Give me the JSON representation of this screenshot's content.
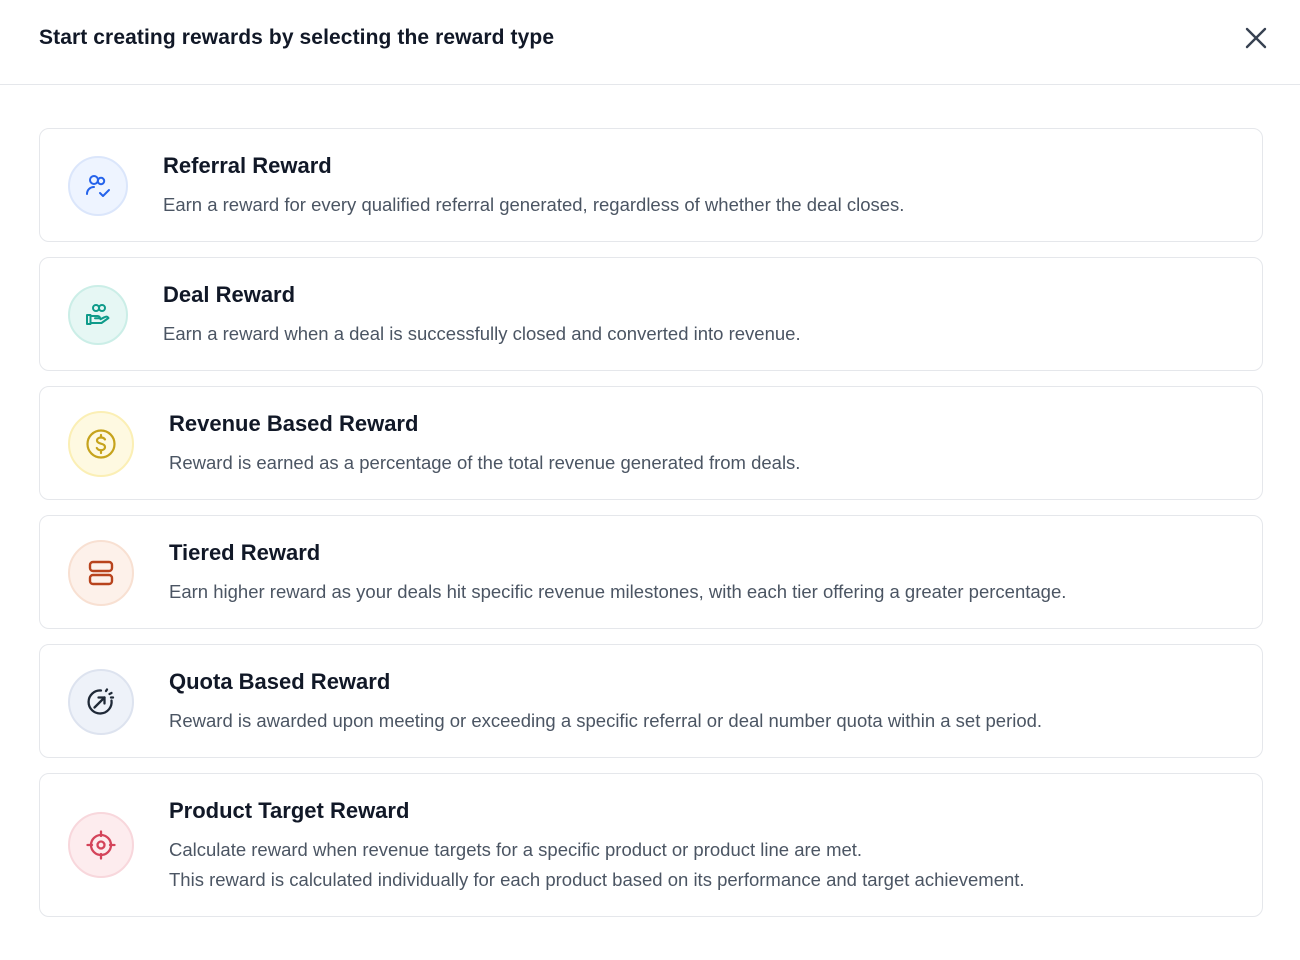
{
  "modal": {
    "title": "Start creating rewards by selecting the reward type"
  },
  "reward_types": [
    {
      "title": "Referral Reward",
      "description": "Earn a reward for every qualified referral generated, regardless of whether the deal closes.",
      "icon": "users-check-icon",
      "color": "#2563eb",
      "bg": "#eef4ff"
    },
    {
      "title": "Deal Reward",
      "description": "Earn a reward when a deal is successfully closed and converted into revenue.",
      "icon": "hand-coins-icon",
      "color": "#0f9b8a",
      "bg": "#e6f7f4"
    },
    {
      "title": "Revenue Based Reward",
      "description": "Reward is earned as a percentage of the total revenue generated from deals.",
      "icon": "dollar-circle-icon",
      "color": "#c6a31c",
      "bg": "#fef9e1"
    },
    {
      "title": "Tiered Reward",
      "description": "Earn higher reward as your deals hit specific revenue milestones, with each tier offering a greater percentage.",
      "icon": "tiers-icon",
      "color": "#b8431c",
      "bg": "#fdf1ea"
    },
    {
      "title": "Quota Based Reward",
      "description": "Reward is awarded upon meeting or exceeding a specific referral or deal number quota within a set period.",
      "icon": "target-arrow-icon",
      "color": "#1f2937",
      "bg": "#eef2f9"
    },
    {
      "title": "Product Target Reward",
      "description_line1": "Calculate reward when revenue targets for a specific product or product line are met.",
      "description_line2": "This reward is calculated individually for each product based on its performance and target achievement.",
      "icon": "crosshair-icon",
      "color": "#d4445a",
      "bg": "#fdecee"
    }
  ]
}
